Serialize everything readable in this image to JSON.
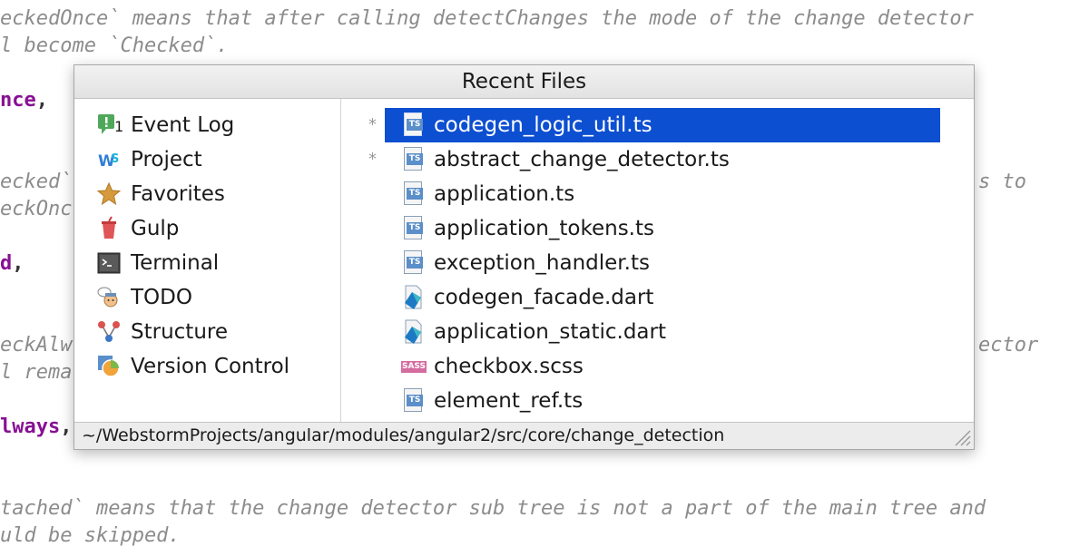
{
  "editor": {
    "lines": [
      {
        "text": "eckedOnce` means that after calling detectChanges the mode of the change detector",
        "style": "comment"
      },
      {
        "text": "l become `Checked`.",
        "style": "comment"
      },
      {
        "text": "nce",
        "style": "keyword",
        "suffix": ","
      },
      {
        "text": "ecked`",
        "style": "comment"
      },
      {
        "text": "eckOnc",
        "style": "comment"
      },
      {
        "text": "s to",
        "style": "comment"
      },
      {
        "text": "d",
        "style": "keyword",
        "suffix": ","
      },
      {
        "text": "eckAlw",
        "style": "comment"
      },
      {
        "text": "l rema",
        "style": "comment"
      },
      {
        "text": "ector",
        "style": "comment"
      },
      {
        "text": "lways",
        "style": "keyword",
        "suffix": ","
      },
      {
        "text": "tached` means that the change detector sub tree is not a part of the main tree and",
        "style": "comment"
      },
      {
        "text": "uld be skipped.",
        "style": "comment"
      }
    ]
  },
  "popup": {
    "title": "Recent Files",
    "tool_windows": [
      {
        "label": "Event Log",
        "icon": "event-log-icon",
        "badge": "1"
      },
      {
        "label": "Project",
        "icon": "webstorm-project-icon"
      },
      {
        "label": "Favorites",
        "icon": "star-icon"
      },
      {
        "label": "Gulp",
        "icon": "gulp-icon"
      },
      {
        "label": "Terminal",
        "icon": "terminal-icon"
      },
      {
        "label": "TODO",
        "icon": "todo-icon"
      },
      {
        "label": "Structure",
        "icon": "structure-icon"
      },
      {
        "label": "Version Control",
        "icon": "version-control-icon"
      }
    ],
    "files": [
      {
        "name": "codegen_logic_util.ts",
        "icon": "ts-file-icon",
        "modified": "*",
        "selected": true
      },
      {
        "name": "abstract_change_detector.ts",
        "icon": "ts-file-icon",
        "modified": "*"
      },
      {
        "name": "application.ts",
        "icon": "ts-file-icon"
      },
      {
        "name": "application_tokens.ts",
        "icon": "ts-file-icon"
      },
      {
        "name": "exception_handler.ts",
        "icon": "ts-file-icon"
      },
      {
        "name": "codegen_facade.dart",
        "icon": "dart-file-icon"
      },
      {
        "name": "application_static.dart",
        "icon": "dart-file-icon"
      },
      {
        "name": "checkbox.scss",
        "icon": "sass-file-icon"
      },
      {
        "name": "element_ref.ts",
        "icon": "ts-file-icon"
      }
    ],
    "ts_badge": "TS",
    "sass_badge": "SASS",
    "path": "~/WebstormProjects/angular/modules/angular2/src/core/change_detection"
  },
  "colors": {
    "selection": "#0d4fd1",
    "keyword": "#871094",
    "comment": "#8c8c8c"
  }
}
